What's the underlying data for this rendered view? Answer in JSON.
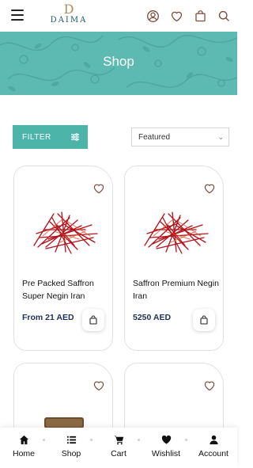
{
  "header": {
    "logo_mark": "D",
    "logo_text": "DAIMA",
    "icons": [
      "menu-icon",
      "account-icon",
      "wishlist-icon",
      "bag-icon",
      "search-icon"
    ]
  },
  "banner": {
    "title": "Shop",
    "background": "#5dbab3"
  },
  "toolbar": {
    "filter_label": "FILTER",
    "sort_value": "Featured"
  },
  "products": [
    {
      "name": "Pre Packed Saffron Super Negin Iran",
      "price": "From 21 AED"
    },
    {
      "name": "Saffron Premium Negin Iran",
      "price": "5250 AED"
    },
    {
      "name": "",
      "price": ""
    },
    {
      "name": "",
      "price": ""
    }
  ],
  "nav": [
    {
      "label": "Home",
      "icon": "home-icon"
    },
    {
      "label": "Shop",
      "icon": "list-icon"
    },
    {
      "label": "Cart",
      "icon": "cart-icon"
    },
    {
      "label": "Wishlist",
      "icon": "heart-icon"
    },
    {
      "label": "Account",
      "icon": "user-icon"
    }
  ],
  "colors": {
    "accent": "#4db4aa",
    "price": "#1d2f5a",
    "logo_gold": "#b08b5a",
    "logo_teal": "#1c5b6b"
  }
}
